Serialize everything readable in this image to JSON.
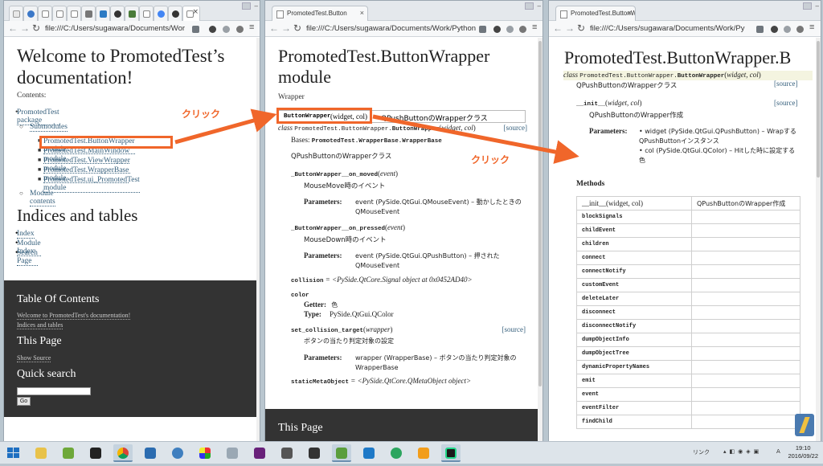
{
  "window1": {
    "url": "file:///C:/Users/sugawara/Documents/Wor",
    "title": "Welcome to PromotedTest’s documentation!",
    "contents_label": "Contents:",
    "toc": {
      "package": "PromotedTest package",
      "submodules": "Submodules",
      "modules": [
        "PromotedTest.ButtonWrapper module",
        "PromotedTest.MainWindow module",
        "PromotedTest.ViewWrapper module",
        "PromotedTest.WrapperBase module",
        "PromotedTest.ui_PromotedTest module"
      ],
      "module_contents": "Module contents"
    },
    "indices_title": "Indices and tables",
    "indices": [
      "Index",
      "Module Index",
      "Search Page"
    ],
    "sidebar": {
      "toc_title": "Table Of Contents",
      "toc_links": [
        "Welcome to PromotedTest's documentation!",
        "Indices and tables"
      ],
      "this_page_title": "This Page",
      "show_source": "Show Source",
      "quick_search_title": "Quick search",
      "go_label": "Go"
    }
  },
  "window2": {
    "tab_title": "PromotedTest.Button",
    "url": "file:///C:/Users/sugawara/Documents/Work/Python",
    "title": "PromotedTest.ButtonWrapper module",
    "module_desc": "Wrapper",
    "class_sig_name": "ButtonWrapper",
    "class_sig_params": "(widget, col)",
    "class_sig_doc": "QPushButtonのWrapperクラス",
    "class_prefix": "class",
    "class_path": "PromotedTest.ButtonWrapper.",
    "class_name": "ButtonWrapper",
    "class_params": "widget, col",
    "source_label": "[source]",
    "bases_label": "Bases:",
    "bases_value": "PromotedTest.WrapperBase.WrapperBase",
    "class_doc": "QPushButtonのWrapperクラス",
    "on_moved_name": "_ButtonWrapper__on_moved",
    "on_moved_param": "event",
    "on_moved_doc": "MouseMove時のイベント",
    "params_label": "Parameters:",
    "on_moved_param_line": "event (PySide.QtGui.QMouseEvent) – 動かしたときのQMouseEvent",
    "on_pressed_name": "_ButtonWrapper__on_pressed",
    "on_pressed_param": "event",
    "on_pressed_doc": "MouseDown時のイベント",
    "on_pressed_param_line": "event (PySide.QtGui.QPushButton) – 押されたQMouseEvent",
    "collision_name": "collision",
    "collision_value": "= <PySide.QtCore.Signal object at 0x0452AD40>",
    "color_name": "color",
    "getter_label": "Getter:",
    "getter_value": "色",
    "type_label": "Type:",
    "type_value": "PySide.QtGui.QColor",
    "set_collision_name": "set_collision_target",
    "set_collision_param": "wrapper",
    "set_collision_doc": "ボタンの当たり判定対象の設定",
    "set_collision_param_line": "wrapper (WrapperBase) – ボタンの当たり判定対象のWrapperBase",
    "static_name": "staticMetaObject",
    "static_value": "= <PySide.QtCore.QMetaObject object>",
    "sidebar_title": "This Page"
  },
  "window3": {
    "tab_title": "PromotedTest.ButtonW",
    "url": "file:///C:/Users/sugawara/Documents/Work/Py",
    "title": "PromotedTest.ButtonWrapper.B",
    "class_prefix": "class",
    "class_path": "PromotedTest.ButtonWrapper.",
    "class_name": "ButtonWrapper",
    "class_params": "widget, col",
    "class_doc": "QPushButtonのWrapperクラス",
    "source_label": "[source]",
    "init_name": "__init__",
    "init_params": "widget, col",
    "init_doc": "QPushButtonのWrapper作成",
    "params_label": "Parameters:",
    "param1": "widget (PySide.QtGui.QPushButton) – WrapするQPushButtonインスタンス",
    "param2": "col (PySide.QtGui.QColor) – Hitした時に設定する色",
    "methods_title": "Methods",
    "methods": [
      {
        "name": "__init__(widget, col)",
        "doc": "QPushButtonのWrapper作成"
      },
      {
        "name": "blockSignals",
        "doc": ""
      },
      {
        "name": "childEvent",
        "doc": ""
      },
      {
        "name": "children",
        "doc": ""
      },
      {
        "name": "connect",
        "doc": ""
      },
      {
        "name": "connectNotify",
        "doc": ""
      },
      {
        "name": "customEvent",
        "doc": ""
      },
      {
        "name": "deleteLater",
        "doc": ""
      },
      {
        "name": "disconnect",
        "doc": ""
      },
      {
        "name": "disconnectNotify",
        "doc": ""
      },
      {
        "name": "dumpObjectInfo",
        "doc": ""
      },
      {
        "name": "dumpObjectTree",
        "doc": ""
      },
      {
        "name": "dynamicPropertyNames",
        "doc": ""
      },
      {
        "name": "emit",
        "doc": ""
      },
      {
        "name": "event",
        "doc": ""
      },
      {
        "name": "eventFilter",
        "doc": ""
      },
      {
        "name": "findChild",
        "doc": ""
      }
    ]
  },
  "annotations": {
    "click1": "クリック",
    "click2": "クリック",
    "color": "#f0662a"
  },
  "taskbar": {
    "tray_label": "リンク",
    "ime_label": "A",
    "time": "19:10",
    "date": "2016/09/22"
  }
}
